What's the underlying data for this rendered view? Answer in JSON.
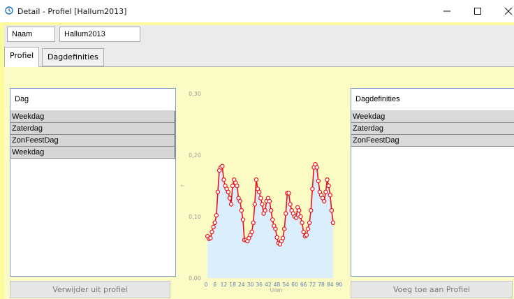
{
  "window": {
    "title": "Detail - Profiel [Hallum2013]",
    "minimize_glyph": "─",
    "maximize_glyph": "☐",
    "close_glyph": "✕"
  },
  "form": {
    "name_label": "Naam",
    "name_value": "Hallum2013"
  },
  "tabs": [
    {
      "label": "Profiel",
      "active": true
    },
    {
      "label": "Dagdefinities",
      "active": false
    }
  ],
  "profile_list": {
    "header": "Dag",
    "items": [
      "Weekdag",
      "Zaterdag",
      "ZonFeestDag",
      "Weekdag"
    ]
  },
  "definitions_list": {
    "header": "Dagdefinities",
    "items": [
      "Weekdag",
      "Zaterdag",
      "ZonFeestDag"
    ]
  },
  "buttons": {
    "remove": "Verwijder uit profiel",
    "add": "Voeg toe aan Profiel"
  },
  "colors": {
    "accent_line": "#e8141b",
    "area_fill": "#dbeefc",
    "window_border": "#fbfb9b"
  },
  "chart_data": {
    "type": "line",
    "xlabel": "Uren",
    "ylabel": "?",
    "ylim": [
      0,
      0.3
    ],
    "xlim": [
      0,
      95
    ],
    "y_ticks": [
      "0,00",
      "0,10",
      "0,20",
      "0,30"
    ],
    "x_ticks": [
      0,
      6,
      12,
      18,
      24,
      30,
      36,
      42,
      48,
      54,
      60,
      66,
      72,
      78,
      84,
      90
    ],
    "area_filled": true,
    "series": [
      {
        "values": [
          0.068,
          0.064,
          0.065,
          0.075,
          0.083,
          0.09,
          0.102,
          0.14,
          0.175,
          0.18,
          0.182,
          0.16,
          0.15,
          0.145,
          0.14,
          0.13,
          0.12,
          0.15,
          0.16,
          0.155,
          0.15,
          0.13,
          0.125,
          0.11,
          0.095,
          0.062,
          0.062,
          0.06,
          0.065,
          0.07,
          0.075,
          0.09,
          0.12,
          0.16,
          0.145,
          0.14,
          0.13,
          0.12,
          0.105,
          0.11,
          0.125,
          0.13,
          0.125,
          0.11,
          0.095,
          0.085,
          0.08,
          0.066,
          0.057,
          0.055,
          0.06,
          0.065,
          0.08,
          0.105,
          0.138,
          0.138,
          0.12,
          0.11,
          0.105,
          0.1,
          0.098,
          0.115,
          0.11,
          0.1,
          0.09,
          0.075,
          0.068,
          0.07,
          0.08,
          0.09,
          0.11,
          0.145,
          0.18,
          0.185,
          0.18,
          0.158,
          0.14,
          0.135,
          0.13,
          0.125,
          0.14,
          0.16,
          0.15,
          0.135,
          0.11,
          0.09
        ]
      }
    ]
  }
}
